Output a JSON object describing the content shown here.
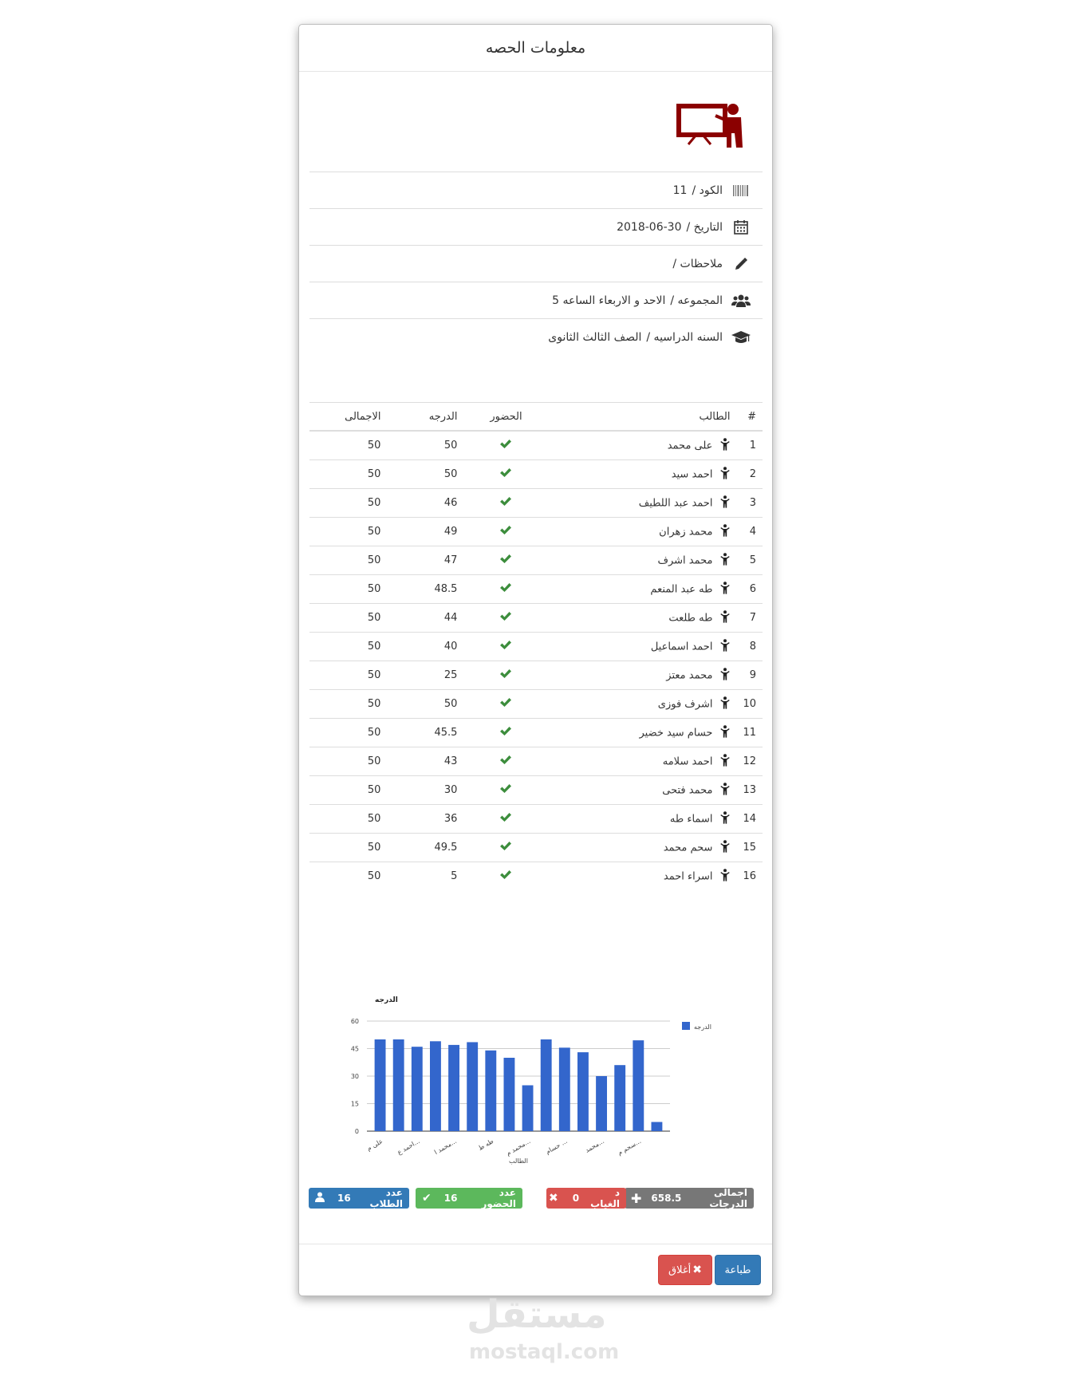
{
  "modal": {
    "title": "معلومات الحصه",
    "info": [
      {
        "label": "الكود /",
        "value": "11",
        "icon": "barcode-icon"
      },
      {
        "label": "التاريخ /",
        "value": "2018-06-30",
        "icon": "calendar-icon"
      },
      {
        "label": "ملاحظات /",
        "value": "",
        "icon": "pencil-icon"
      },
      {
        "label": "المجموعه /",
        "value": "الاحد و الاربعاء الساعه 5",
        "icon": "users-icon"
      },
      {
        "label": "السنه الدراسيه /",
        "value": "الصف الثالث الثانوى",
        "icon": "graduation-cap-icon"
      }
    ],
    "table": {
      "headers": {
        "num": "#",
        "student": "الطالب",
        "attendance": "الحضور",
        "grade": "الدرجه",
        "total": "الاجمالى"
      },
      "rows": [
        {
          "num": "1",
          "name": "على محمد",
          "grade": "50",
          "total": "50"
        },
        {
          "num": "2",
          "name": "احمد سيد",
          "grade": "50",
          "total": "50"
        },
        {
          "num": "3",
          "name": "احمد عبد اللطيف",
          "grade": "46",
          "total": "50"
        },
        {
          "num": "4",
          "name": "محمد زهران",
          "grade": "49",
          "total": "50"
        },
        {
          "num": "5",
          "name": "محمد اشرف",
          "grade": "47",
          "total": "50"
        },
        {
          "num": "6",
          "name": "طه عبد المنعم",
          "grade": "48.5",
          "total": "50"
        },
        {
          "num": "7",
          "name": "طه طلعت",
          "grade": "44",
          "total": "50"
        },
        {
          "num": "8",
          "name": "احمد اسماعيل",
          "grade": "40",
          "total": "50"
        },
        {
          "num": "9",
          "name": "محمد معتز",
          "grade": "25",
          "total": "50"
        },
        {
          "num": "10",
          "name": "اشرف فوزى",
          "grade": "50",
          "total": "50"
        },
        {
          "num": "11",
          "name": "حسام سيد خضير",
          "grade": "45.5",
          "total": "50"
        },
        {
          "num": "12",
          "name": "احمد سلامه",
          "grade": "43",
          "total": "50"
        },
        {
          "num": "13",
          "name": "محمد فتحى",
          "grade": "30",
          "total": "50"
        },
        {
          "num": "14",
          "name": "اسماء طه",
          "grade": "36",
          "total": "50"
        },
        {
          "num": "15",
          "name": "سحم محمد",
          "grade": "49.5",
          "total": "50"
        },
        {
          "num": "16",
          "name": "اسراء احمد",
          "grade": "5",
          "total": "50"
        }
      ]
    },
    "chart_data": {
      "type": "bar",
      "title": "الدرجه",
      "xlabel": "الطالب",
      "ylabel": "",
      "ylim": [
        0,
        60
      ],
      "yticks": [
        "0",
        "15",
        "30",
        "45",
        "60"
      ],
      "legend_position": "top-right",
      "grid": true,
      "categories": [
        "على م",
        "احمد س",
        "احمد ع",
        "محمد ز",
        "محمد ا",
        "طه ع",
        "طه ط",
        "احمد ا",
        "محمد م",
        "اشرف ف",
        "حسام",
        "احمد س",
        "محمد",
        "اسماء ط",
        "سحم م",
        "اسراء ا"
      ],
      "tick_labels": [
        "على م",
        "احمد ع...",
        "محمد ا...",
        "طه ط",
        "محمد م...",
        "حسام ...",
        "محمد...",
        "سحم م..."
      ],
      "series": [
        {
          "name": "الدرجه",
          "values": [
            50,
            50,
            46,
            49,
            47,
            48.5,
            44,
            40,
            25,
            50,
            45.5,
            43,
            30,
            36,
            49.5,
            5
          ]
        }
      ]
    },
    "badges": {
      "total_grades_label": "اجمالى الدرجات",
      "total_grades_value": "658.5",
      "absence_label": "د الغياب",
      "absence_value": "0",
      "attendance_label": "عدد الحضور",
      "attendance_value": "16",
      "students_label": "عدد الطلاب",
      "students_value": "16"
    },
    "buttons": {
      "print": "طباعة",
      "close": "أغلاق"
    }
  },
  "watermark": {
    "ar": "مستقل",
    "en": "mostaql.com"
  },
  "colors": {
    "bar": "#3366cc",
    "check": "#3c8d3c",
    "logo": "#8b0000",
    "badge_gray": "#777777",
    "badge_red": "#d9534f",
    "badge_green": "#5cb85c",
    "badge_blue": "#337ab7"
  }
}
